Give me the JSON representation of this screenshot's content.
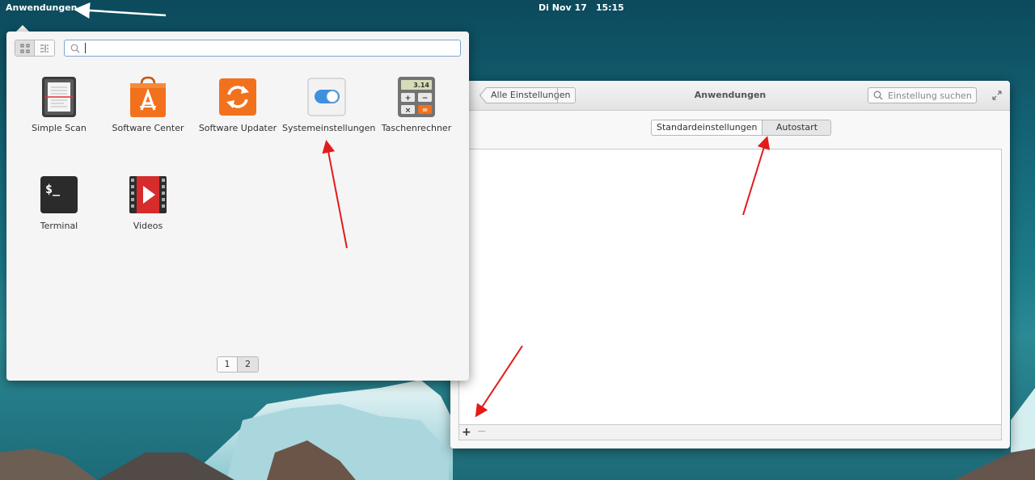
{
  "panel": {
    "applications_label": "Anwendungen",
    "date": "Di Nov 17",
    "time": "15:15"
  },
  "app_menu": {
    "view_modes": [
      {
        "icon": "grid-view-icon"
      },
      {
        "icon": "category-view-icon"
      }
    ],
    "search": {
      "value": "",
      "placeholder": ""
    },
    "apps": [
      {
        "label": "Simple Scan",
        "icon": "scanner-icon"
      },
      {
        "label": "Software Center",
        "icon": "software-center-icon"
      },
      {
        "label": "Software Updater",
        "icon": "software-updater-icon"
      },
      {
        "label": "Systemeinstellungen",
        "icon": "system-settings-icon"
      },
      {
        "label": "Taschenrechner",
        "icon": "calculator-icon"
      },
      {
        "label": "Terminal",
        "icon": "terminal-icon"
      },
      {
        "label": "Videos",
        "icon": "videos-icon"
      }
    ],
    "pages": [
      "1",
      "2"
    ],
    "current_page": "2"
  },
  "settings_window": {
    "back_label": "Alle Einstellungen",
    "title": "Anwendungen",
    "search_placeholder": "Einstellung suchen",
    "tabs": [
      {
        "label": "Standardeinstellungen",
        "active": false
      },
      {
        "label": "Autostart",
        "active": true
      }
    ],
    "toolbar": {
      "add": "+",
      "remove": "−"
    }
  },
  "calculator_display": "3.14",
  "calculator_keys": [
    "+",
    "−",
    "×",
    "="
  ],
  "terminal_prompt": "$_",
  "colors": {
    "annotation_arrow": "#e31b1b",
    "accent_blue": "#3d8fe0",
    "orange": "#f2711c"
  }
}
